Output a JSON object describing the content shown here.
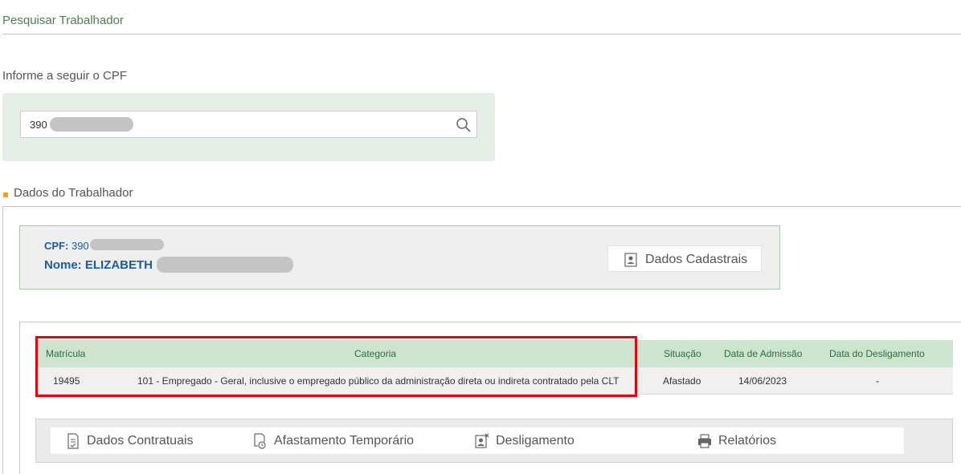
{
  "page": {
    "title": "Pesquisar Trabalhador"
  },
  "search": {
    "prompt": "Informe a seguir o CPF",
    "value": "390",
    "search_icon": "search-icon"
  },
  "section": {
    "label": "Dados do Trabalhador"
  },
  "worker": {
    "cpf_label": "CPF:",
    "cpf_value": "390",
    "name_label": "Nome:",
    "name_value": "ELIZABETH",
    "cadastrais_button": "Dados Cadastrais"
  },
  "table": {
    "headers": [
      "Matrícula",
      "Categoria",
      "Situação",
      "Data de Admissão",
      "Data do Desligamento"
    ],
    "rows": [
      [
        "19495",
        "101 - Empregado - Geral, inclusive o empregado público da administração direta ou indireta contratado pela CLT",
        "Afastado",
        "14/06/2023",
        "-"
      ]
    ]
  },
  "actions": {
    "contratuais": "Dados Contratuais",
    "afastamento": "Afastamento Temporário",
    "desligamento": "Desligamento",
    "relatorios": "Relatórios"
  },
  "colors": {
    "accent_green": "#4f7f52",
    "header_green": "#cde4d1",
    "highlight_red": "#e8000d",
    "bullet": "#f2a413",
    "link_blue": "#1f5b9a"
  }
}
